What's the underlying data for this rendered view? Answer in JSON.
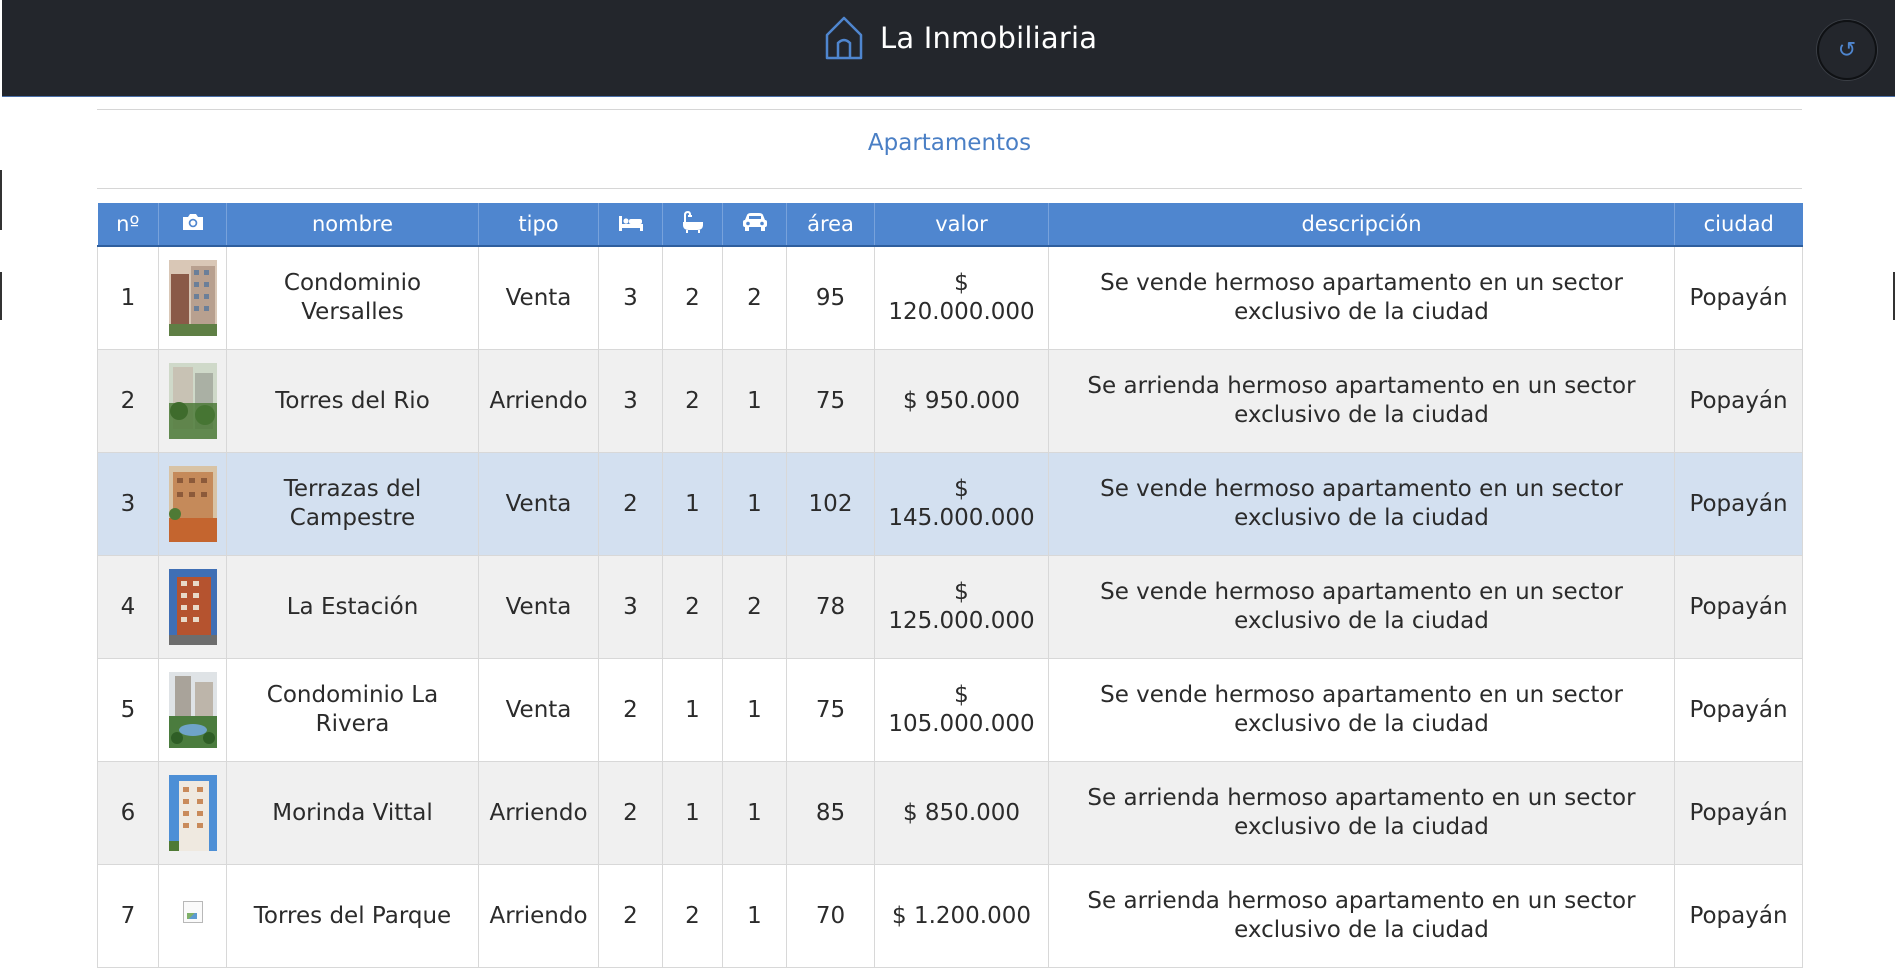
{
  "app": {
    "title": "La Inmobiliaria",
    "brand_icon": "house-outline-icon",
    "refresh_icon": "refresh-icon",
    "refresh_glyph": "↺",
    "colors": {
      "header_bg": "#23262c",
      "accent": "#4f86cf",
      "selected_row": "#d3e0f0"
    }
  },
  "section": {
    "title": "Apartamentos"
  },
  "table": {
    "columns": [
      {
        "key": "n",
        "label": "nº"
      },
      {
        "key": "photo",
        "label": "",
        "icon": "camera-icon"
      },
      {
        "key": "nombre",
        "label": "nombre"
      },
      {
        "key": "tipo",
        "label": "tipo"
      },
      {
        "key": "beds",
        "label": "",
        "icon": "bed-icon"
      },
      {
        "key": "baths",
        "label": "",
        "icon": "bathtub-icon"
      },
      {
        "key": "parking",
        "label": "",
        "icon": "car-icon"
      },
      {
        "key": "area",
        "label": "área"
      },
      {
        "key": "valor",
        "label": "valor"
      },
      {
        "key": "descripcion",
        "label": "descripción"
      },
      {
        "key": "ciudad",
        "label": "ciudad"
      }
    ],
    "rows": [
      {
        "n": "1",
        "photo": "building-photo-1",
        "nombre": "Condominio Versalles",
        "tipo": "Venta",
        "beds": "3",
        "baths": "2",
        "parking": "2",
        "area": "95",
        "valor": "$ 120.000.000",
        "descripcion": "Se vende hermoso apartamento en un sector exclusivo de la ciudad",
        "ciudad": "Popayán"
      },
      {
        "n": "2",
        "photo": "building-photo-2",
        "nombre": "Torres del Rio",
        "tipo": "Arriendo",
        "beds": "3",
        "baths": "2",
        "parking": "1",
        "area": "75",
        "valor": "$ 950.000",
        "descripcion": "Se arrienda hermoso apartamento en un sector exclusivo de la ciudad",
        "ciudad": "Popayán"
      },
      {
        "n": "3",
        "photo": "building-photo-3",
        "nombre": "Terrazas del Campestre",
        "tipo": "Venta",
        "beds": "2",
        "baths": "1",
        "parking": "1",
        "area": "102",
        "valor": "$ 145.000.000",
        "descripcion": "Se vende hermoso apartamento en un sector exclusivo de la ciudad",
        "ciudad": "Popayán",
        "selected": true
      },
      {
        "n": "4",
        "photo": "building-photo-4",
        "nombre": "La Estación",
        "tipo": "Venta",
        "beds": "3",
        "baths": "2",
        "parking": "2",
        "area": "78",
        "valor": "$ 125.000.000",
        "descripcion": "Se vende hermoso apartamento en un sector exclusivo de la ciudad",
        "ciudad": "Popayán"
      },
      {
        "n": "5",
        "photo": "building-photo-5",
        "nombre": "Condominio La Rivera",
        "tipo": "Venta",
        "beds": "2",
        "baths": "1",
        "parking": "1",
        "area": "75",
        "valor": "$ 105.000.000",
        "descripcion": "Se vende hermoso apartamento en un sector exclusivo de la ciudad",
        "ciudad": "Popayán"
      },
      {
        "n": "6",
        "photo": "building-photo-6",
        "nombre": "Morinda Vittal",
        "tipo": "Arriendo",
        "beds": "2",
        "baths": "1",
        "parking": "1",
        "area": "85",
        "valor": "$ 850.000",
        "descripcion": "Se arrienda hermoso apartamento en un sector exclusivo de la ciudad",
        "ciudad": "Popayán"
      },
      {
        "n": "7",
        "photo": "broken-image-icon",
        "nombre": "Torres del Parque",
        "tipo": "Arriendo",
        "beds": "2",
        "baths": "2",
        "parking": "1",
        "area": "70",
        "valor": "$ 1.200.000",
        "descripcion": "Se arrienda hermoso apartamento en un sector exclusivo de la ciudad",
        "ciudad": "Popayán"
      }
    ]
  }
}
